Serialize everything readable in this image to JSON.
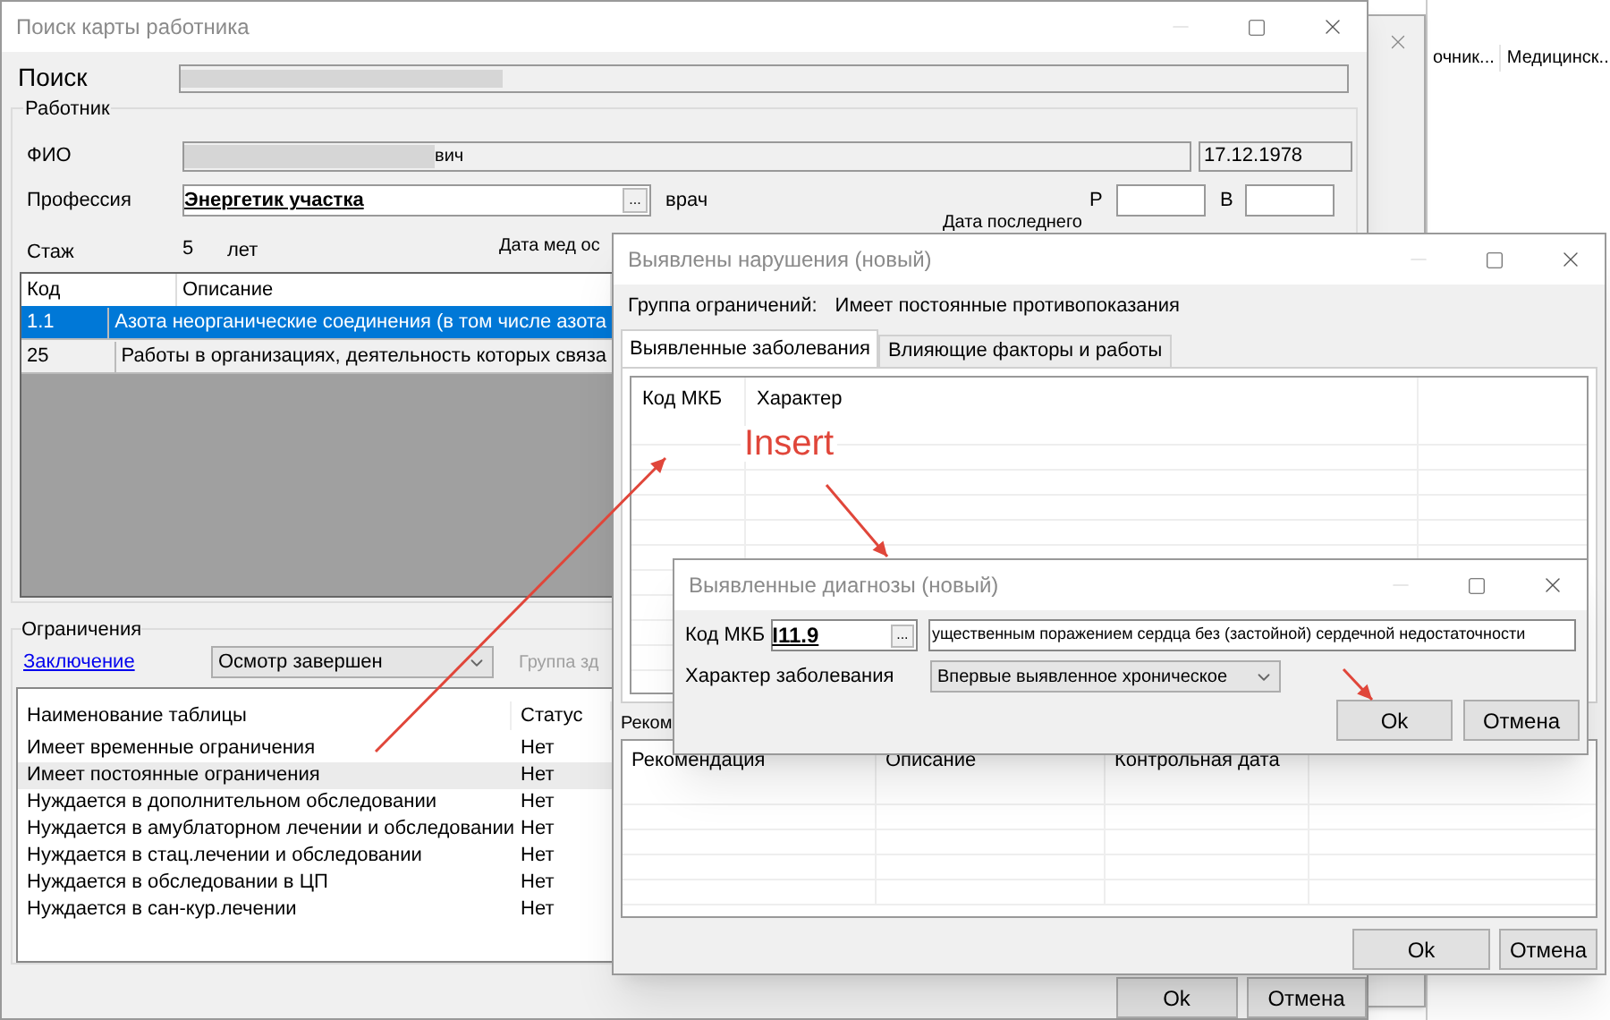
{
  "background_window": {
    "columns": [
      "очник...",
      "Медицинск..."
    ]
  },
  "main_window": {
    "title": "Поиск карты работника",
    "search_label": "Поиск",
    "worker_group": "Работник",
    "fio_label": "ФИО",
    "fio_suffix": "вич",
    "birth_date": "17.12.1978",
    "profession_label": "Профессия",
    "profession_value": "Энергетик участка",
    "browse_button": "...",
    "doctor_label": "врач",
    "r_label": "Р",
    "v_label": "В",
    "experience_label": "Стаж",
    "experience_value": "5",
    "experience_unit": "лет",
    "exam_date_label": "Дата мед ос",
    "last_date_label": "Дата последнего",
    "factors_table": {
      "columns": [
        "Код",
        "Описание"
      ],
      "rows": [
        {
          "code": "1.1",
          "description": "Азота неорганические соединения (в том числе азота",
          "selected": true
        },
        {
          "code": "25",
          "description": "Работы в организациях, деятельность которых связа",
          "selected": false
        }
      ]
    },
    "restrictions_group": "Ограничения",
    "conclusion_link": "Заключение",
    "status_combo": "Осмотр завершен",
    "health_group_label": "Группа зд",
    "restrictions_list": {
      "columns": [
        "Наименование таблицы",
        "Статус"
      ],
      "rows": [
        {
          "name": "Имеет временные ограничения",
          "status": "Нет",
          "selected": false
        },
        {
          "name": "Имеет постоянные ограничения",
          "status": "Нет",
          "selected": true
        },
        {
          "name": "Нуждается в дополнительном обследовании",
          "status": "Нет",
          "selected": false
        },
        {
          "name": "Нуждается в амублаторном лечении и обследовании",
          "status": "Нет",
          "selected": false
        },
        {
          "name": "Нуждается в стац.лечении и обследовании",
          "status": "Нет",
          "selected": false
        },
        {
          "name": "Нуждается в обследовании в ЦП",
          "status": "Нет",
          "selected": false
        },
        {
          "name": "Нуждается в сан-кур.лечении",
          "status": "Нет",
          "selected": false
        }
      ]
    },
    "buttons": [
      "Ok",
      "Отмена"
    ]
  },
  "violations_dialog": {
    "title": "Выявлены нарушения (новый)",
    "group_label": "Группа ограничений:",
    "group_value": "Имеет постоянные противопоказания",
    "tabs": [
      {
        "label": "Выявленные заболевания",
        "selected": true
      },
      {
        "label": "Влияющие факторы и работы",
        "selected": false
      }
    ],
    "diseases_columns": [
      "Код МКБ",
      "Характер"
    ],
    "recommendations_label": "Реком",
    "recommendations_columns": [
      "Рекомендация",
      "Описание",
      "Контрольная дата"
    ],
    "buttons": [
      "Ok",
      "Отмена"
    ]
  },
  "diagnosis_dialog": {
    "title": "Выявленные диагнозы (новый)",
    "code_label": "Код МКБ",
    "code_value": "I11.9",
    "browse_button": "...",
    "diagnosis_text": "ущественным поражением сердца без (застойной) сердечной недостаточности",
    "nature_label": "Характер заболевания",
    "nature_value": "Впервые выявленное хроническое",
    "buttons": [
      "Ok",
      "Отмена"
    ]
  },
  "annotations": {
    "insert_label": "Insert"
  }
}
